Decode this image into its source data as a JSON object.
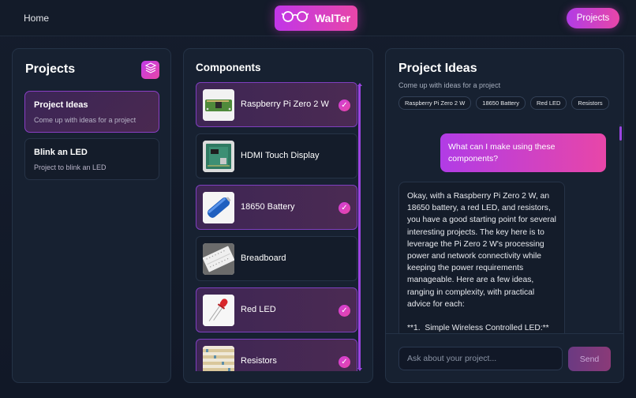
{
  "nav": {
    "home_label": "Home",
    "brand": "WalTer",
    "projects_label": "Projects"
  },
  "projects_panel": {
    "title": "Projects",
    "items": [
      {
        "title": "Project Ideas",
        "subtitle": "Come up with ideas for a project",
        "active": true
      },
      {
        "title": "Blink an LED",
        "subtitle": "Project to blink an LED",
        "active": false
      }
    ]
  },
  "components_panel": {
    "title": "Components",
    "items": [
      {
        "name": "Raspberry Pi Zero 2 W",
        "selected": true,
        "icon": "raspberry-pi-image"
      },
      {
        "name": "HDMI Touch Display",
        "selected": false,
        "icon": "touch-display-image"
      },
      {
        "name": "18650 Battery",
        "selected": true,
        "icon": "battery-image"
      },
      {
        "name": "Breadboard",
        "selected": false,
        "icon": "breadboard-image"
      },
      {
        "name": "Red LED",
        "selected": true,
        "icon": "red-led-image"
      },
      {
        "name": "Resistors",
        "selected": true,
        "icon": "resistors-image"
      }
    ],
    "check_glyph": "✓"
  },
  "idea_panel": {
    "title": "Project Ideas",
    "subtitle": "Come up with ideas for a project",
    "chips": [
      "Raspberry Pi Zero 2 W",
      "18650 Battery",
      "Red LED",
      "Resistors"
    ],
    "user_message": "What can I make using these components?",
    "ai_message": "Okay, with a Raspberry Pi Zero 2 W, an 18650 battery, a red LED, and resistors, you have a good starting point for several interesting projects. The key here is to leverage the Pi Zero 2 W's processing power and network connectivity while keeping the power requirements manageable. Here are a few ideas, ranging in complexity, with practical advice for each:\n\n**1.  Simple Wireless Controlled LED:**",
    "input_placeholder": "Ask about your project...",
    "send_label": "Send"
  },
  "colors": {
    "accent_start": "#b13ce6",
    "accent_end": "#e846a8",
    "background": "#111827",
    "panel": "#172131"
  }
}
